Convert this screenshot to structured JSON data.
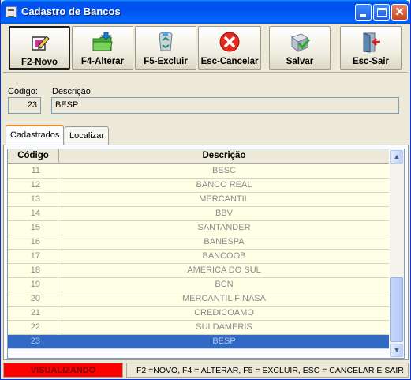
{
  "window": {
    "title": "Cadastro de Bancos"
  },
  "toolbar": {
    "buttons": [
      {
        "label": "F2-Novo",
        "icon": "new-record-icon"
      },
      {
        "label": "F4-Alterar",
        "icon": "edit-folder-icon"
      },
      {
        "label": "F5-Excluir",
        "icon": "recycle-bin-icon"
      },
      {
        "label": "Esc-Cancelar",
        "icon": "cancel-icon"
      },
      {
        "label": "Salvar",
        "icon": "save-icon"
      },
      {
        "label": "Esc-Sair",
        "icon": "exit-door-icon"
      }
    ]
  },
  "form": {
    "codigo_label": "Código:",
    "codigo_value": "23",
    "descricao_label": "Descrição:",
    "descricao_value": "BESP"
  },
  "tabs": [
    "Cadastrados",
    "Localizar"
  ],
  "grid": {
    "columns": [
      "Código",
      "Descrição"
    ],
    "rows": [
      {
        "codigo": "11",
        "descricao": "BESC"
      },
      {
        "codigo": "12",
        "descricao": "BANCO REAL"
      },
      {
        "codigo": "13",
        "descricao": "MERCANTIL"
      },
      {
        "codigo": "14",
        "descricao": "BBV"
      },
      {
        "codigo": "15",
        "descricao": "SANTANDER"
      },
      {
        "codigo": "16",
        "descricao": "BANESPA"
      },
      {
        "codigo": "17",
        "descricao": "BANCOOB"
      },
      {
        "codigo": "18",
        "descricao": "AMERICA DO SUL"
      },
      {
        "codigo": "19",
        "descricao": "BCN"
      },
      {
        "codigo": "20",
        "descricao": "MERCANTIL FINASA"
      },
      {
        "codigo": "21",
        "descricao": "CREDICOAMO"
      },
      {
        "codigo": "22",
        "descricao": "SULDAMERIS"
      },
      {
        "codigo": "23",
        "descricao": "BESP"
      }
    ],
    "selected_codigo": "23"
  },
  "status": {
    "mode": "VISUALIZANDO",
    "help": "F2 =NOVO, F4 = ALTERAR, F5 = EXCLUIR, ESC = CANCELAR E SAIR"
  },
  "colors": {
    "title_bar": "#0055ea",
    "selected_row": "#316ac5",
    "row_background": "#ffffe6",
    "status_mode_bg": "#ff0000"
  }
}
